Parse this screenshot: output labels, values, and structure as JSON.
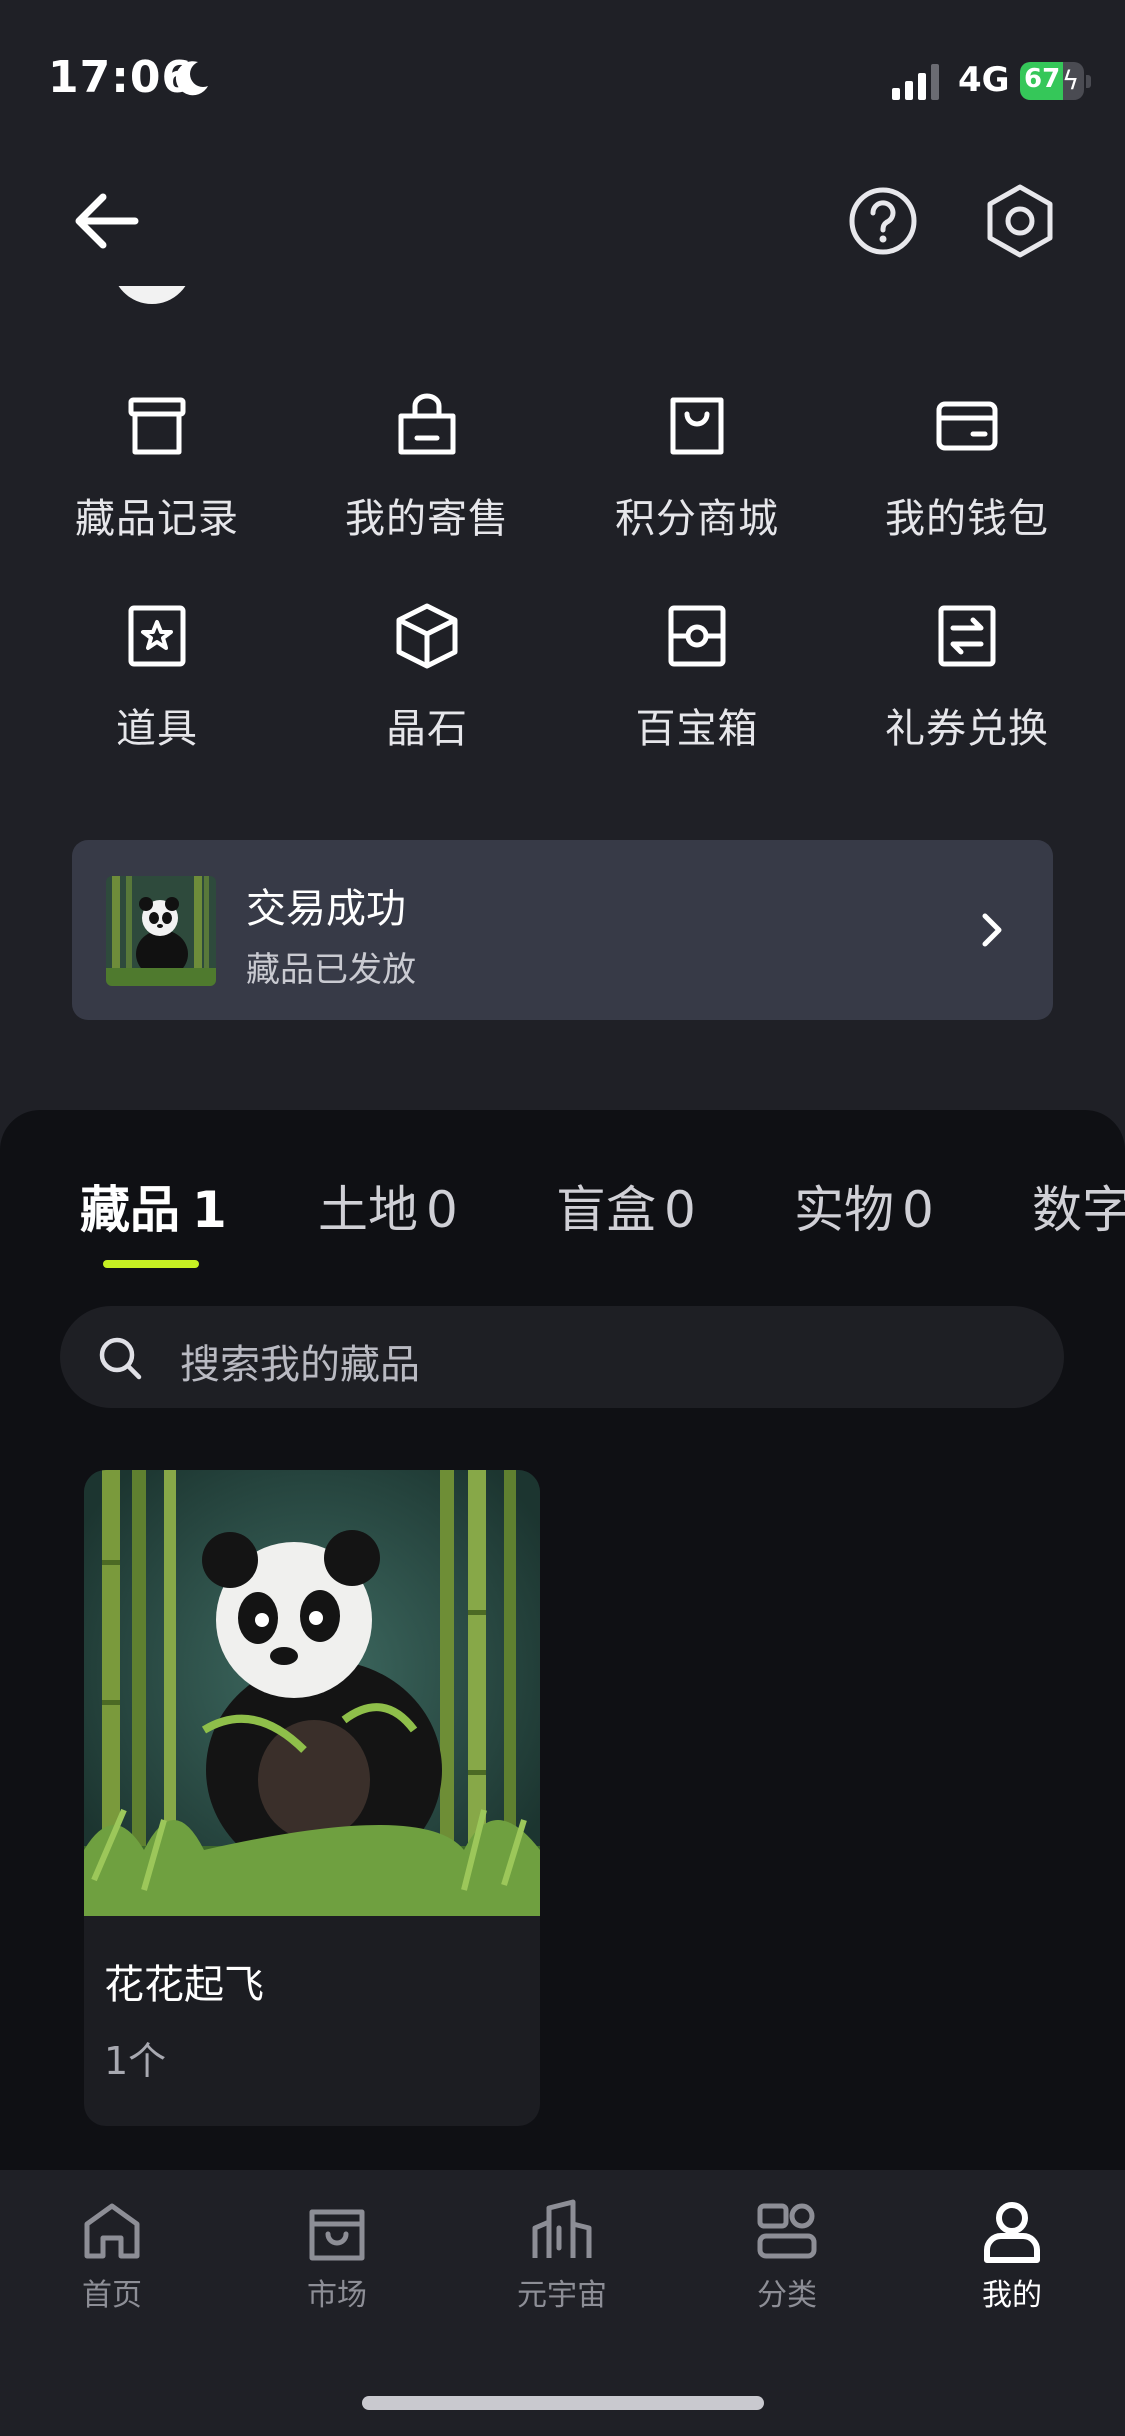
{
  "status_bar": {
    "time": "17:06",
    "network": "4G",
    "battery_percent": "67",
    "battery_level": 0.67
  },
  "menu": [
    {
      "label": "藏品记录",
      "icon": "archive-box-icon"
    },
    {
      "label": "我的寄售",
      "icon": "shopping-bag-icon"
    },
    {
      "label": "积分商城",
      "icon": "store-bag-icon"
    },
    {
      "label": "我的钱包",
      "icon": "wallet-icon"
    },
    {
      "label": "道具",
      "icon": "star-badge-icon"
    },
    {
      "label": "晶石",
      "icon": "cube-icon"
    },
    {
      "label": "百宝箱",
      "icon": "treasure-box-icon"
    },
    {
      "label": "礼券兑换",
      "icon": "exchange-icon"
    }
  ],
  "notice": {
    "title": "交易成功",
    "subtitle": "藏品已发放"
  },
  "tabs": [
    {
      "label": "藏品",
      "count": "1",
      "active": true
    },
    {
      "label": "土地",
      "count": "0",
      "active": false
    },
    {
      "label": "盲盒",
      "count": "0",
      "active": false
    },
    {
      "label": "实物",
      "count": "0",
      "active": false
    },
    {
      "label": "数字",
      "count": "",
      "active": false
    }
  ],
  "search": {
    "placeholder": "搜索我的藏品"
  },
  "items": [
    {
      "name": "花花起飞",
      "count": "1个"
    }
  ],
  "bottom_nav": [
    {
      "label": "首页",
      "icon": "home-icon",
      "active": false
    },
    {
      "label": "市场",
      "icon": "market-bag-icon",
      "active": false
    },
    {
      "label": "元宇宙",
      "icon": "buildings-icon",
      "active": false
    },
    {
      "label": "分类",
      "icon": "category-icon",
      "active": false
    },
    {
      "label": "我的",
      "icon": "user-icon",
      "active": true
    }
  ],
  "colors": {
    "accent": "#c6f023",
    "background": "#1f2026",
    "panel": "#0f1014",
    "card": "#373a47"
  }
}
